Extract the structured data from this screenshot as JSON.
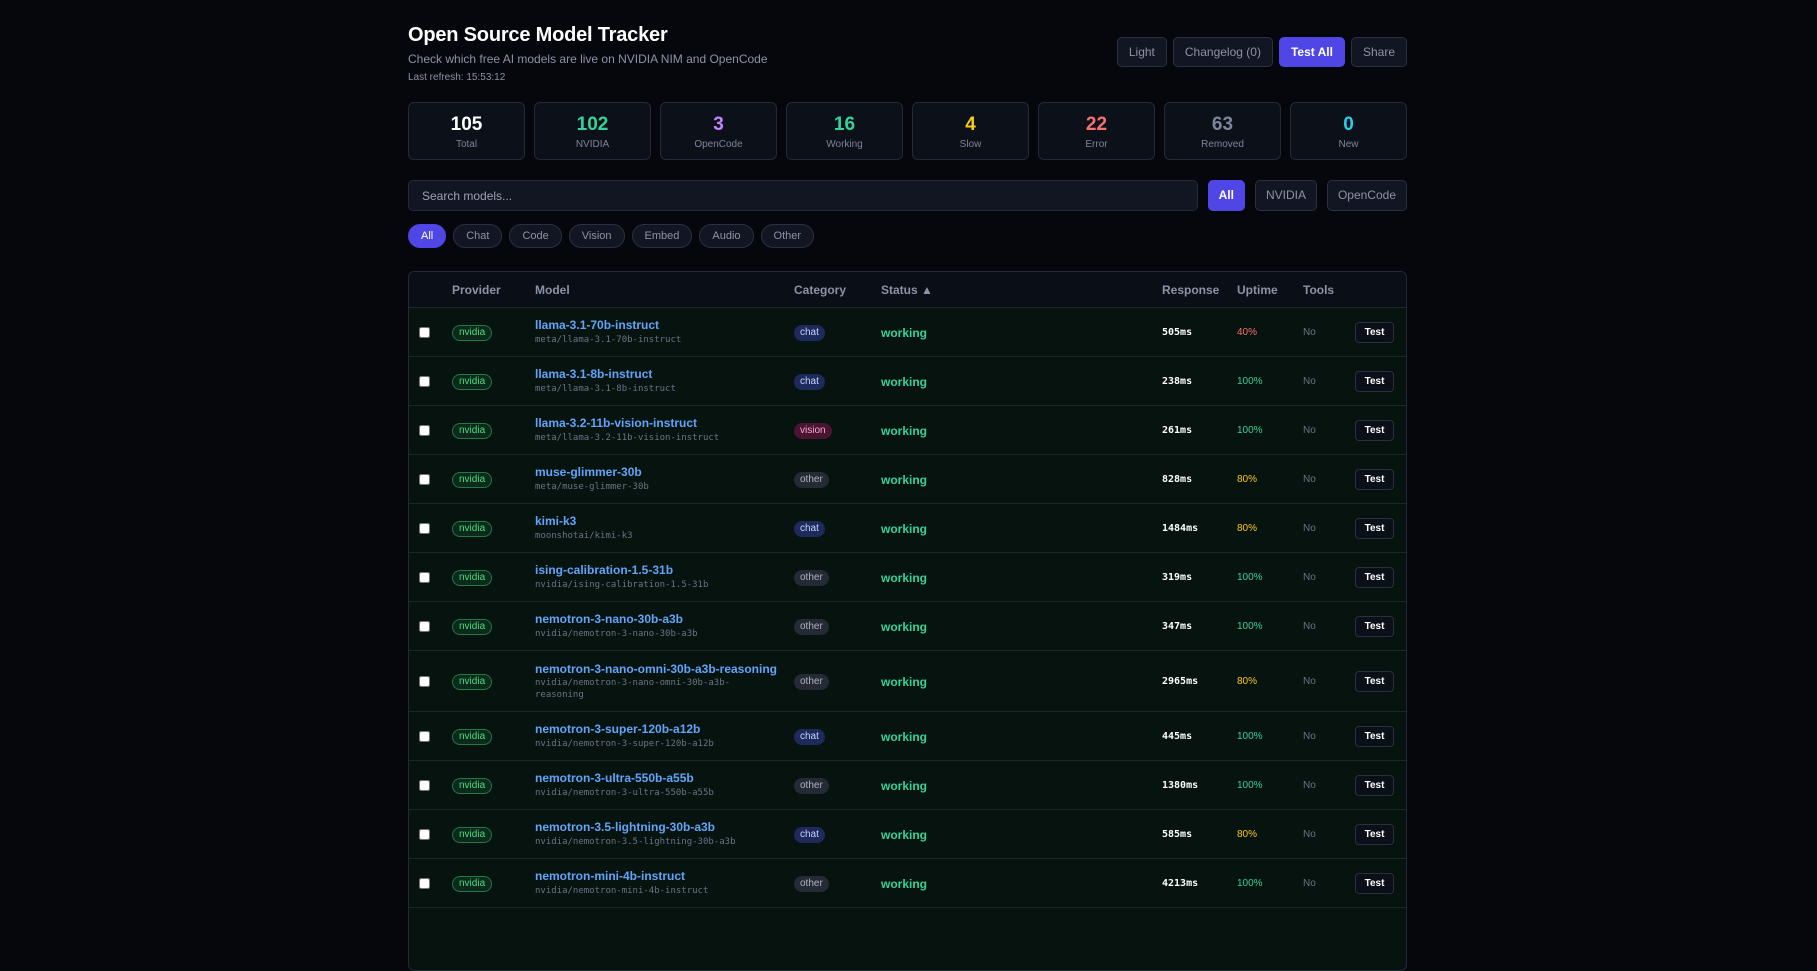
{
  "header": {
    "title": "Open Source Model Tracker",
    "subtitle": "Check which free AI models are live on NVIDIA NIM and OpenCode",
    "last_refresh": "Last refresh: 15:53:12",
    "buttons": {
      "light": "Light",
      "changelog": "Changelog (0)",
      "test_all": "Test All",
      "share": "Share"
    }
  },
  "stats": [
    {
      "value": "105",
      "label": "Total",
      "color": "#ffffff"
    },
    {
      "value": "102",
      "label": "NVIDIA",
      "color": "#34d399"
    },
    {
      "value": "3",
      "label": "OpenCode",
      "color": "#c084fc"
    },
    {
      "value": "16",
      "label": "Working",
      "color": "#34d399"
    },
    {
      "value": "4",
      "label": "Slow",
      "color": "#facc15"
    },
    {
      "value": "22",
      "label": "Error",
      "color": "#f87171"
    },
    {
      "value": "63",
      "label": "Removed",
      "color": "#7d8599"
    },
    {
      "value": "0",
      "label": "New",
      "color": "#22d3ee"
    }
  ],
  "search": {
    "placeholder": "Search models..."
  },
  "provider_filters": {
    "all": "All",
    "nvidia": "NVIDIA",
    "opencode": "OpenCode"
  },
  "category_filters": [
    "All",
    "Chat",
    "Code",
    "Vision",
    "Embed",
    "Audio",
    "Other"
  ],
  "table": {
    "columns": {
      "provider": "Provider",
      "model": "Model",
      "category": "Category",
      "status": "Status ▲",
      "response": "Response",
      "uptime": "Uptime",
      "tools": "Tools"
    },
    "test_label": "Test",
    "colors": {
      "uptime_high": "#34d399",
      "uptime_mid": "#facc15",
      "uptime_low": "#f87171"
    },
    "rows": [
      {
        "provider": "nvidia",
        "name": "llama-3.1-70b-instruct",
        "id": "meta/llama-3.1-70b-instruct",
        "category": "chat",
        "status": "working",
        "response": "505ms",
        "uptime": "40%",
        "uptime_level": "low",
        "tools": "No"
      },
      {
        "provider": "nvidia",
        "name": "llama-3.1-8b-instruct",
        "id": "meta/llama-3.1-8b-instruct",
        "category": "chat",
        "status": "working",
        "response": "238ms",
        "uptime": "100%",
        "uptime_level": "high",
        "tools": "No"
      },
      {
        "provider": "nvidia",
        "name": "llama-3.2-11b-vision-instruct",
        "id": "meta/llama-3.2-11b-vision-instruct",
        "category": "vision",
        "status": "working",
        "response": "261ms",
        "uptime": "100%",
        "uptime_level": "high",
        "tools": "No"
      },
      {
        "provider": "nvidia",
        "name": "muse-glimmer-30b",
        "id": "meta/muse-glimmer-30b",
        "category": "other",
        "status": "working",
        "response": "828ms",
        "uptime": "80%",
        "uptime_level": "mid",
        "tools": "No"
      },
      {
        "provider": "nvidia",
        "name": "kimi-k3",
        "id": "moonshotai/kimi-k3",
        "category": "chat",
        "status": "working",
        "response": "1484ms",
        "uptime": "80%",
        "uptime_level": "mid",
        "tools": "No"
      },
      {
        "provider": "nvidia",
        "name": "ising-calibration-1.5-31b",
        "id": "nvidia/ising-calibration-1.5-31b",
        "category": "other",
        "status": "working",
        "response": "319ms",
        "uptime": "100%",
        "uptime_level": "high",
        "tools": "No"
      },
      {
        "provider": "nvidia",
        "name": "nemotron-3-nano-30b-a3b",
        "id": "nvidia/nemotron-3-nano-30b-a3b",
        "category": "other",
        "status": "working",
        "response": "347ms",
        "uptime": "100%",
        "uptime_level": "high",
        "tools": "No"
      },
      {
        "provider": "nvidia",
        "name": "nemotron-3-nano-omni-30b-a3b-reasoning",
        "id": "nvidia/nemotron-3-nano-omni-30b-a3b-reasoning",
        "category": "other",
        "status": "working",
        "response": "2965ms",
        "uptime": "80%",
        "uptime_level": "mid",
        "tools": "No"
      },
      {
        "provider": "nvidia",
        "name": "nemotron-3-super-120b-a12b",
        "id": "nvidia/nemotron-3-super-120b-a12b",
        "category": "chat",
        "status": "working",
        "response": "445ms",
        "uptime": "100%",
        "uptime_level": "high",
        "tools": "No"
      },
      {
        "provider": "nvidia",
        "name": "nemotron-3-ultra-550b-a55b",
        "id": "nvidia/nemotron-3-ultra-550b-a55b",
        "category": "other",
        "status": "working",
        "response": "1380ms",
        "uptime": "100%",
        "uptime_level": "high",
        "tools": "No"
      },
      {
        "provider": "nvidia",
        "name": "nemotron-3.5-lightning-30b-a3b",
        "id": "nvidia/nemotron-3.5-lightning-30b-a3b",
        "category": "chat",
        "status": "working",
        "response": "585ms",
        "uptime": "80%",
        "uptime_level": "mid",
        "tools": "No"
      },
      {
        "provider": "nvidia",
        "name": "nemotron-mini-4b-instruct",
        "id": "nvidia/nemotron-mini-4b-instruct",
        "category": "other",
        "status": "working",
        "response": "4213ms",
        "uptime": "100%",
        "uptime_level": "high",
        "tools": "No"
      }
    ]
  }
}
